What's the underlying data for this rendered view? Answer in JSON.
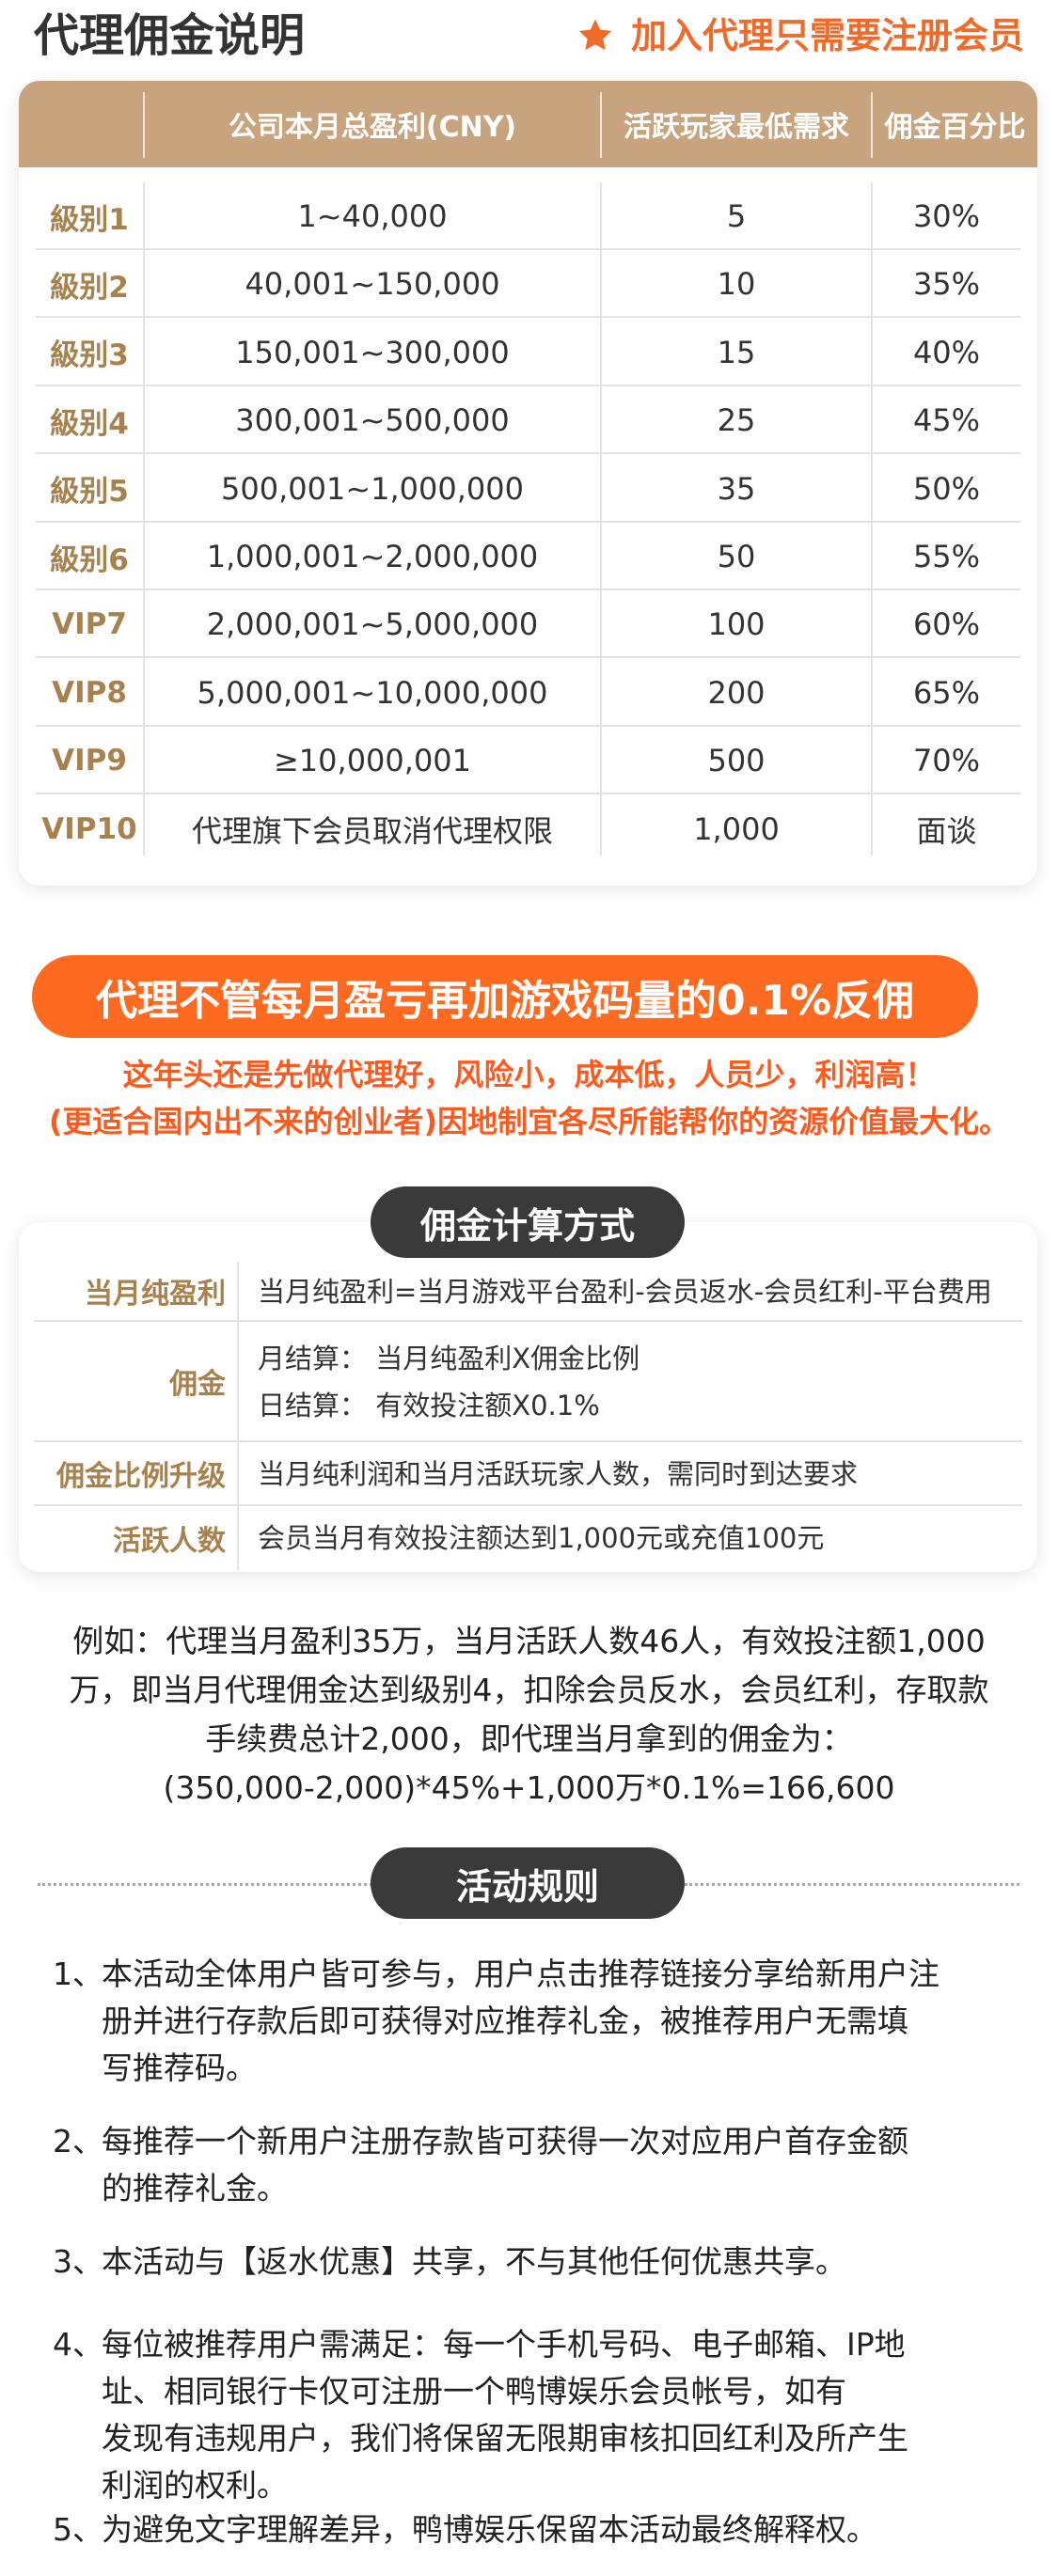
{
  "header": {
    "title": "代理佣金说明",
    "note": "加入代理只需要注册会员",
    "star_icon": "star-icon",
    "accent_color": "#f06a2a"
  },
  "commission_table": {
    "columns": [
      "",
      "公司本月总盈利(CNY)",
      "活跃玩家最低需求",
      "佣金百分比"
    ],
    "rows": [
      {
        "level": "級别1",
        "profit": "1~40,000",
        "players": "5",
        "percent": "30%"
      },
      {
        "level": "級别2",
        "profit": "40,001~150,000",
        "players": "10",
        "percent": "35%"
      },
      {
        "level": "級别3",
        "profit": "150,001~300,000",
        "players": "15",
        "percent": "40%"
      },
      {
        "level": "級别4",
        "profit": "300,001~500,000",
        "players": "25",
        "percent": "45%"
      },
      {
        "level": "級别5",
        "profit": "500,001~1,000,000",
        "players": "35",
        "percent": "50%"
      },
      {
        "level": "級别6",
        "profit": "1,000,001~2,000,000",
        "players": "50",
        "percent": "55%"
      },
      {
        "level": "VIP7",
        "profit": "2,000,001~5,000,000",
        "players": "100",
        "percent": "60%"
      },
      {
        "level": "VIP8",
        "profit": "5,000,001~10,000,000",
        "players": "200",
        "percent": "65%"
      },
      {
        "level": "VIP9",
        "profit": "≥10,000,001",
        "players": "500",
        "percent": "70%"
      },
      {
        "level": "VIP10",
        "profit": "代理旗下会员取消代理权限",
        "players": "1,000",
        "percent": "面谈"
      }
    ]
  },
  "banner": {
    "text": "代理不管每月盈亏再加游戏码量的0.1%反佣",
    "line1": "这年头还是先做代理好，风险小，成本低，人员少，利润高！",
    "line2": "(更适合国内出不来的创业者)因地制宜各尽所能帮你的资源价值最大化。"
  },
  "calc": {
    "title": "佣金计算方式",
    "rows": [
      {
        "label": "当月纯盈利",
        "lines": [
          "当月纯盈利=当月游戏平台盈利-会员返水-会员红利-平台费用"
        ]
      },
      {
        "label": "佣金",
        "lines": [
          "月结算：  当月纯盈利X佣金比例",
          "日结算：  有效投注额X0.1%"
        ]
      },
      {
        "label": "佣金比例升级",
        "lines": [
          "当月纯利润和当月活跃玩家人数，需同时到达要求"
        ]
      },
      {
        "label": "活跃人数",
        "lines": [
          "会员当月有效投注额达到1,000元或充值100元"
        ]
      }
    ]
  },
  "example": {
    "lines": [
      "例如：代理当月盈利35万，当月活跃人数46人，有效投注额1,000",
      "万，即当月代理佣金达到级别4，扣除会员反水，会员红利，存取款",
      "手续费总计2,000，即代理当月拿到的佣金为：",
      "(350,000-2,000)*45%+1,000万*0.1%=166,600"
    ]
  },
  "rules": {
    "title": "活动规则",
    "items": [
      {
        "num": "1、",
        "lines": [
          "本活动全体用户皆可参与，用户点击推荐链接分享给新用户注",
          "册并进行存款后即可获得对应推荐礼金，被推荐用户无需填",
          "写推荐码。"
        ]
      },
      {
        "num": "2、",
        "lines": [
          "每推荐一个新用户注册存款皆可获得一次对应用户首存金额",
          "的推荐礼金。"
        ]
      },
      {
        "num": "3、",
        "lines": [
          "本活动与【返水优惠】共享，不与其他任何优惠共享。"
        ]
      },
      {
        "num": "4、",
        "lines": [
          "每位被推荐用户需满足：每一个手机号码、电子邮箱、IP地",
          "址、相同银行卡仅可注册一个鸭博娱乐会员帐号，如有",
          "发现有违规用户，我们将保留无限期审核扣回红利及所产生",
          "利润的权利。"
        ]
      },
      {
        "num": "5、",
        "lines": [
          "为避免文字理解差异，鸭博娱乐保留本活动最终解释权。"
        ]
      }
    ]
  }
}
